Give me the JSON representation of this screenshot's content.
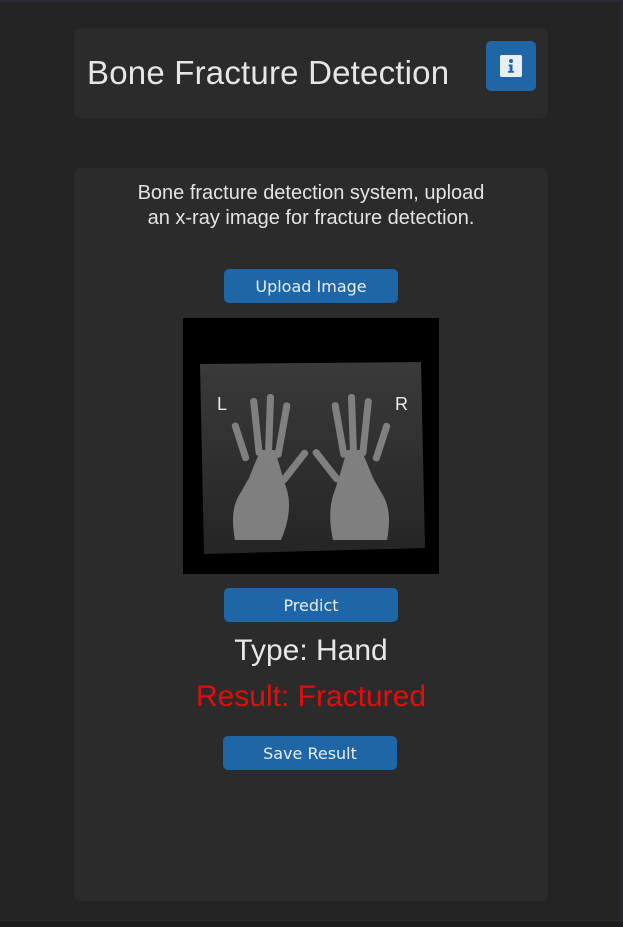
{
  "header": {
    "title": "Bone Fracture Detection",
    "info_icon": "info-icon"
  },
  "main": {
    "description": "Bone fracture detection system, upload an x-ray image for fracture detection.",
    "upload_label": "Upload Image",
    "predict_label": "Predict",
    "type_text": "Type: Hand",
    "result_text": "Result: Fractured",
    "save_label": "Save Result",
    "xray_marker_left": "L",
    "xray_marker_right": "R"
  },
  "colors": {
    "background": "#242424",
    "card": "#2b2b2b",
    "accent": "#1f66a6",
    "result": "#e20d0d"
  }
}
